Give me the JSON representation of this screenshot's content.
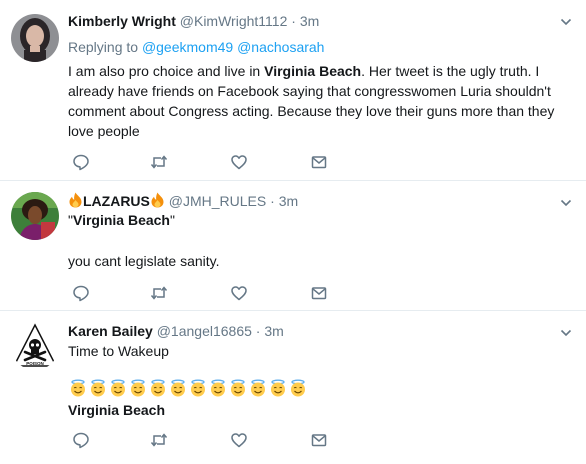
{
  "tweets": [
    {
      "name": "Kimberly Wright",
      "handle": "@KimWright1112",
      "dot": "·",
      "time": "3m",
      "reply_prefix": "Replying to",
      "mentions": [
        "@geekmom49",
        "@nachosarah"
      ],
      "text_before": "I am also pro choice and live in ",
      "text_bold": "Virginia Beach",
      "text_after": ". Her tweet is the ugly truth. I already have friends on Facebook saying that congresswomen Luria shouldn't comment about Congress acting.   Because they love their guns more than they love people",
      "avatar_icon": "woman-portrait-avatar"
    },
    {
      "name": "LAZARUS",
      "name_icons": [
        "fire-icon",
        "fire-icon"
      ],
      "handle": "@JMH_RULES",
      "dot": "·",
      "time": "3m",
      "quote_open": "\"",
      "quote_bold": "Virginia Beach",
      "quote_close": "\"",
      "text": "you cant legislate sanity.",
      "avatar_icon": "colorful-portrait-avatar"
    },
    {
      "name": "Karen Bailey",
      "handle": "@1angel16865",
      "dot": "·",
      "time": "3m",
      "text": "Time to Wakeup",
      "emoji_icon": "smiling-face-with-halo-icon",
      "emoji_count": 12,
      "text_bold": "Virginia Beach",
      "avatar_icon": "poison-skull-avatar",
      "avatar_label": "POISON"
    }
  ],
  "colors": {
    "link": "#1da1f2",
    "secondary_text": "#657786",
    "icon": "#657786",
    "divider": "#e6ecf0",
    "fire": "#f4900c"
  }
}
